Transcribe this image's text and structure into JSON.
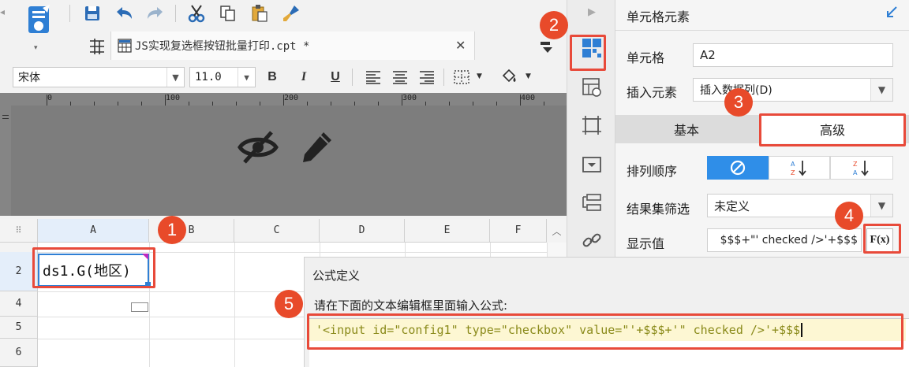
{
  "tab": {
    "file_name": "JS实现复选框按钮批量打印.cpt *",
    "close_glyph": "✕"
  },
  "format_bar": {
    "font_name": "宋体",
    "font_size": "11.0",
    "bold": "B",
    "italic": "I",
    "underline": "U"
  },
  "ruler": {
    "marks": [
      "0",
      "100",
      "200",
      "300",
      "400"
    ]
  },
  "grid": {
    "columns": [
      "A",
      "B",
      "C",
      "D",
      "E",
      "F"
    ],
    "rows": [
      "2",
      "4",
      "5",
      "6"
    ],
    "cell_a2": "ds1.G(地区)"
  },
  "panel": {
    "title": "单元格元素",
    "cell_label": "单元格",
    "cell_value": "A2",
    "insert_label": "插入元素",
    "insert_value": "插入数据列(D)",
    "tab_basic": "基本",
    "tab_advanced": "高级",
    "sort_label": "排列顺序",
    "filter_label": "结果集筛选",
    "filter_value": "未定义",
    "display_label": "显示值",
    "display_value": "$$$+\"' checked />'+$$$",
    "formula_btn": "F(x)"
  },
  "dialog": {
    "title": "公式定义",
    "hint": "请在下面的文本编辑框里面输入公式:",
    "formula": "'<input id=\"config1\" type=\"checkbox\" value=\"'+$$$+'\" checked />'+$$$"
  },
  "callouts": [
    "1",
    "2",
    "3",
    "4",
    "5"
  ],
  "colors": {
    "accent_blue": "#2f7fd4",
    "callout_red": "#e84a2a",
    "highlight_red": "#e84a3a",
    "formula_bg": "#fdf7d3"
  }
}
